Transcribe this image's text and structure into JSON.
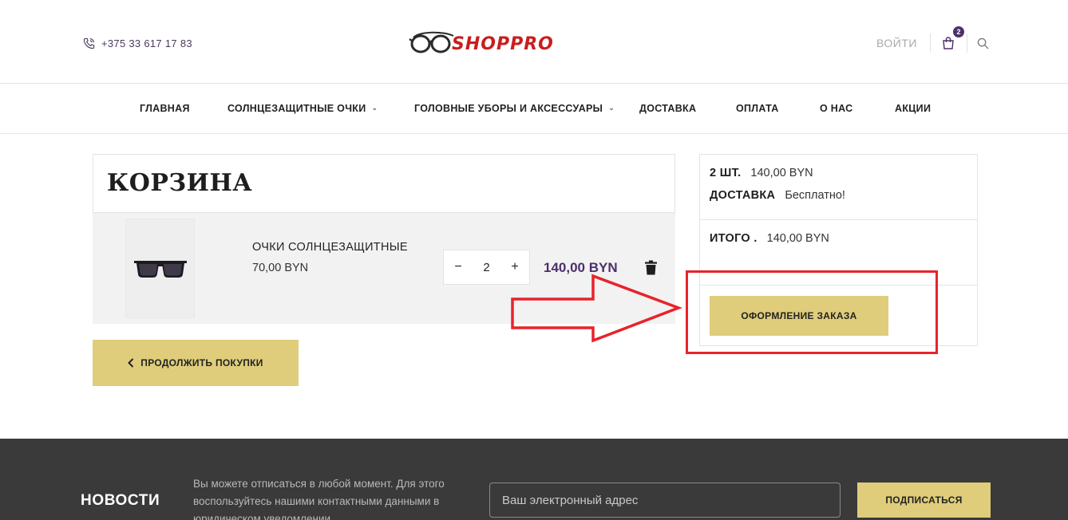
{
  "header": {
    "phone": "+375 33 617 17 83",
    "logo_text": "SHOPPRO",
    "login_label": "ВОЙТИ",
    "cart_count": "2"
  },
  "nav": {
    "items": [
      {
        "label": "ГЛАВНАЯ",
        "has_dropdown": false
      },
      {
        "label": "СОЛНЦЕЗАЩИТНЫЕ ОЧКИ",
        "has_dropdown": true
      },
      {
        "label": "ГОЛОВНЫЕ УБОРЫ И АКСЕССУАРЫ",
        "has_dropdown": true
      },
      {
        "label": "ДОСТАВКА",
        "has_dropdown": false
      },
      {
        "label": "ОПЛАТА",
        "has_dropdown": false
      },
      {
        "label": "О НАС",
        "has_dropdown": false
      },
      {
        "label": "АКЦИИ",
        "has_dropdown": false
      }
    ]
  },
  "cart": {
    "title": "КОРЗИНА",
    "items": [
      {
        "name": "ОЧКИ СОЛНЦЕЗАЩИТНЫЕ",
        "unit_price": "70,00 BYN",
        "quantity": "2",
        "line_total": "140,00 BYN",
        "qty_minus": "−",
        "qty_plus": "+"
      }
    ],
    "continue_label": "ПРОДОЛЖИТЬ ПОКУПКИ"
  },
  "summary": {
    "count_label": "2 ШТ.",
    "count_value": "140,00 BYN",
    "delivery_label": "ДОСТАВКА",
    "delivery_value": "Бесплатно!",
    "total_label": "ИТОГО .",
    "total_value": "140,00 BYN",
    "checkout_label": "ОФОРМЛЕНИЕ ЗАКАЗА"
  },
  "footer": {
    "news_title": "НОВОСТИ",
    "news_text": "Вы можете отписаться в любой момент. Для этого воспользуйтесь нашими контактными данными в юридическом уведомлении.",
    "email_placeholder": "Ваш электронный адрес",
    "subscribe_label": "ПОДПИСАТЬСЯ"
  },
  "colors": {
    "accent_gold": "#dfcd7b",
    "brand_purple": "#4d2f6b",
    "logo_red": "#c81e1e",
    "annotation_red": "#e8232a",
    "footer_bg": "#3a3a3a"
  },
  "icons": [
    "phone-icon",
    "glasses-logo-icon",
    "bag-icon",
    "search-icon",
    "chevron-down-icon",
    "trash-icon",
    "chevron-left-icon"
  ]
}
